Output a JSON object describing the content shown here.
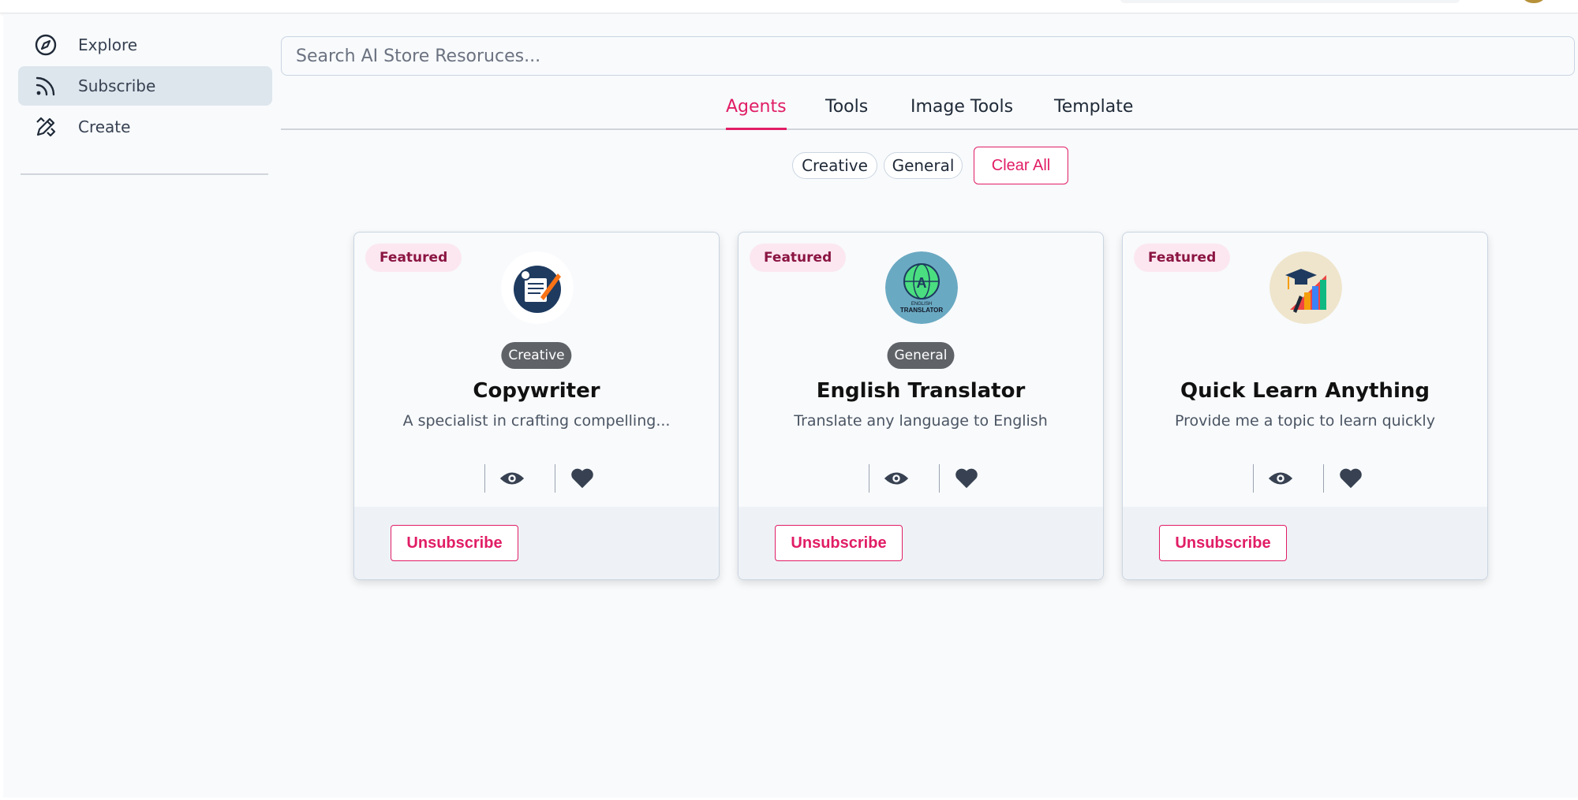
{
  "sidebar": {
    "items": [
      {
        "label": "Explore",
        "icon": "compass-icon",
        "active": false
      },
      {
        "label": "Subscribe",
        "icon": "rss-icon",
        "active": true
      },
      {
        "label": "Create",
        "icon": "pencil-ruler-icon",
        "active": false
      }
    ]
  },
  "search": {
    "placeholder": "Search AI Store Resoruces..."
  },
  "tabs": [
    {
      "label": "Agents",
      "active": true
    },
    {
      "label": "Tools",
      "active": false
    },
    {
      "label": "Image Tools",
      "active": false
    },
    {
      "label": "Template",
      "active": false
    }
  ],
  "filters": {
    "chips": [
      "Creative",
      "General"
    ],
    "clear_label": "Clear All"
  },
  "cards": [
    {
      "featured": "Featured",
      "category": "Creative",
      "title": "Copywriter",
      "description": "A specialist in crafting compelling...",
      "logo": "copywriter-logo",
      "action": "Unsubscribe"
    },
    {
      "featured": "Featured",
      "category": "General",
      "title": "English Translator",
      "description": "Translate any language to English",
      "logo": "english-translator-logo",
      "logo_text_1": "ENGLISH",
      "logo_text_2": "TRANSLATOR",
      "action": "Unsubscribe"
    },
    {
      "featured": "Featured",
      "category": "",
      "title": "Quick Learn Anything",
      "description": "Provide me a topic to learn quickly",
      "logo": "graduation-chart-logo",
      "action": "Unsubscribe"
    }
  ],
  "colors": {
    "accent": "#e11d65",
    "badge_bg": "#fce7f0",
    "badge_text": "#8b1542",
    "category_bg": "#5f6368"
  }
}
